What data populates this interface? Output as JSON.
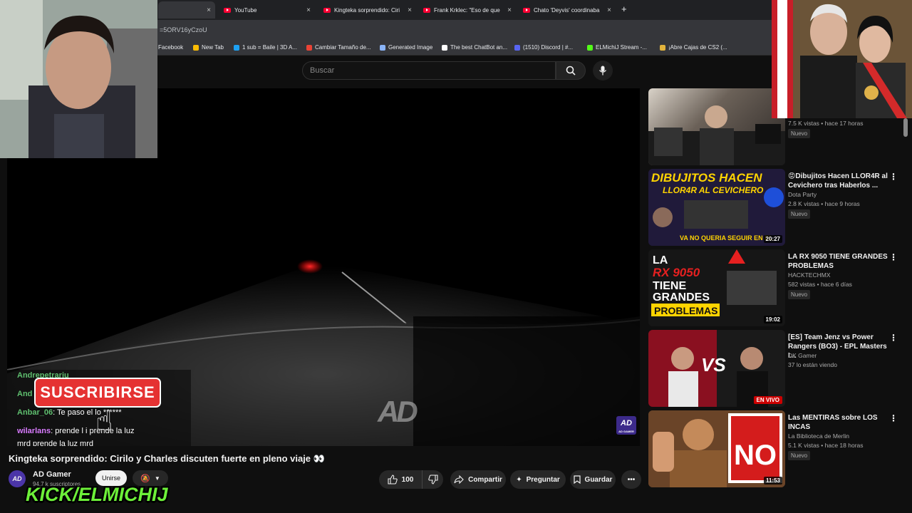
{
  "browser": {
    "tabs": [
      {
        "title": "",
        "active": true
      },
      {
        "title": "YouTube",
        "active": false
      },
      {
        "title": "Kingteka sorprendido: Ciri",
        "active": false
      },
      {
        "title": "Frank Krklec: \"Eso de que",
        "active": false
      },
      {
        "title": "Chato 'Deyvis' coordinaba",
        "active": false
      }
    ],
    "close_glyph": "×",
    "new_tab_glyph": "+",
    "url": "=5ORV16yCzoU",
    "bookmarks": [
      {
        "label": "Facebook",
        "color": "#1877f2"
      },
      {
        "label": "New Tab",
        "color": "#fbbc04"
      },
      {
        "label": "1 sub = Baile | 3D A...",
        "color": "#1da1f2"
      },
      {
        "label": "Cambiar Tamaño de...",
        "color": "#ea4335"
      },
      {
        "label": "Generated Image",
        "color": "#8ab4f8"
      },
      {
        "label": "The best ChatBot an...",
        "color": "#ffffff"
      },
      {
        "label": "(1510) Discord | #...",
        "color": "#5865f2"
      },
      {
        "label": "ELMichiJ Stream -...",
        "color": "#53fc18"
      },
      {
        "label": "¡Abre Cajas de CS2 (...",
        "color": "#e2b33c"
      }
    ]
  },
  "youtube": {
    "search_placeholder": "Buscar",
    "search_icon": "search-icon",
    "mic_icon": "mic-icon"
  },
  "player": {
    "watermark": "AD",
    "corner_logo": "AD",
    "corner_logo_sub": "AD GAMER",
    "subscribe_overlay": "SUSCRIBIRSE",
    "chat": [
      {
        "user": "Andrepetrariu",
        "text": ""
      },
      {
        "user": "And",
        "text": ""
      },
      {
        "user": "Anbar_06",
        "text": ": Te paso el lo ******"
      },
      {
        "user": "wilarlans",
        "text": ": prende l  i prende la luz"
      },
      {
        "user": "",
        "text": "mrd prende la luz mrd"
      }
    ]
  },
  "video": {
    "title": "Kingteka sorprendido: Cirilo y Charles discuten fuerte en pleno viaje 👀",
    "channel": "AD Gamer",
    "channel_avatar": "AD",
    "subscribers": "94,7 k suscriptores",
    "join_label": "Unirse",
    "likes": "100",
    "share_label": "Compartir",
    "ask_label": "Preguntar",
    "save_label": "Guardar",
    "overlay_kick": "KICK/ELMICHIJ"
  },
  "sidebar": {
    "items": [
      {
        "title": "",
        "channel": "",
        "meta": "7.5 K vistas • hace 17 horas",
        "badge": "Nuevo",
        "duration": "",
        "live": false
      },
      {
        "title": "😡Dibujitos Hacen LLOR4R al Cevichero tras Haberlos ...",
        "channel": "Dota Party",
        "meta": "2.8 K vistas • hace 9 horas",
        "badge": "Nuevo",
        "duration": "20:27",
        "live": false,
        "thumb_text": "DIBUJITOS HACEN LLOR4R AL CEVICHERO"
      },
      {
        "title": "LA RX 9050 TIENE GRANDES PROBLEMAS",
        "channel": "HACKTECHMX",
        "meta": "582 vistas • hace 6 días",
        "badge": "Nuevo",
        "duration": "19:02",
        "live": false,
        "thumb_text": "LA RX 9050 TIENE GRANDES PROBLEMAS"
      },
      {
        "title": "[ES] Team Jenz vs Power Rangers (BO3) - EPL Masters I...",
        "channel": "DK Gamer",
        "meta": "37 lo están viendo",
        "badge": "",
        "duration": "",
        "live": true,
        "live_label": "EN VIVO",
        "thumb_text": "VS"
      },
      {
        "title": "Las MENTIRAS sobre LOS INCAS",
        "channel": "La Biblioteca de Merlin",
        "meta": "5.1 K vistas • hace 18 horas",
        "badge": "Nuevo",
        "duration": "11:53",
        "live": false,
        "thumb_text": "NO"
      }
    ]
  }
}
